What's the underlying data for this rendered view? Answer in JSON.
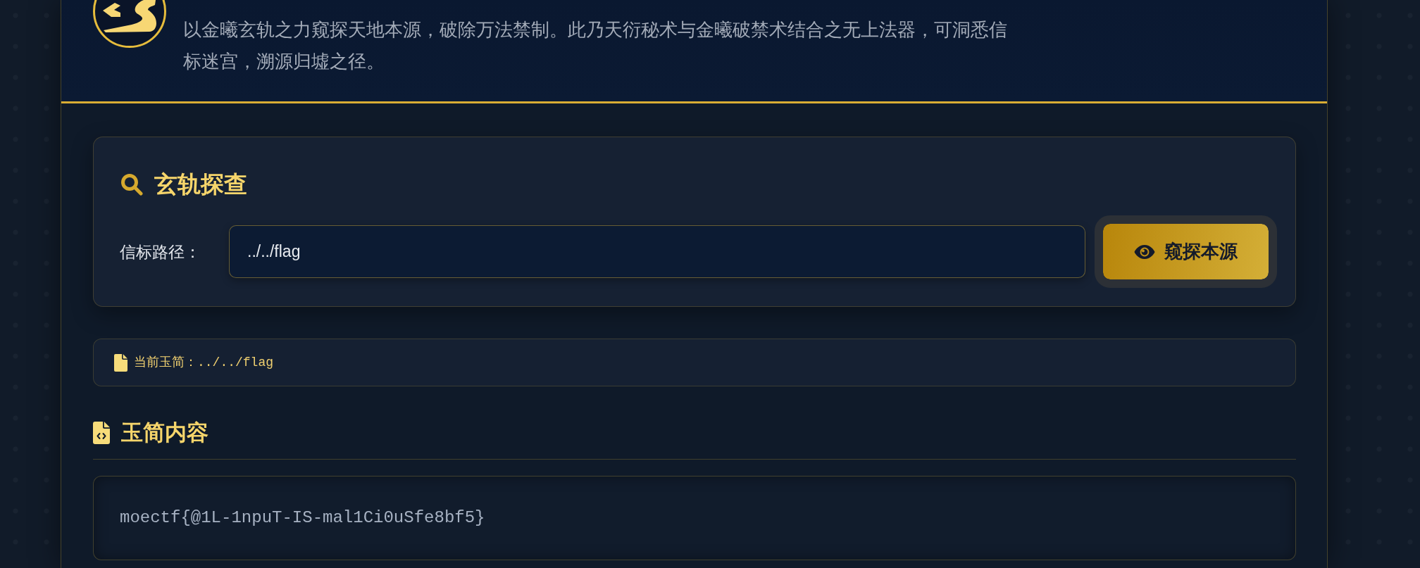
{
  "header": {
    "description": "以金曦玄轨之力窥探天地本源，破除万法禁制。此乃天衍秘术与金曦破禁术结合之无上法器，可洞悉信标迷宫，溯源归墟之径。"
  },
  "search_panel": {
    "title": "玄轨探查",
    "path_field": {
      "label": "信标路径：",
      "value": "../../flag"
    },
    "submit_button": {
      "label": "窥探本源"
    }
  },
  "current_file": {
    "text": "当前玉简：../../flag"
  },
  "content_section": {
    "title": "玉简内容",
    "content": "moectf{@1L-1npuT-IS-mal1Ci0uSfe8bf5}"
  }
}
